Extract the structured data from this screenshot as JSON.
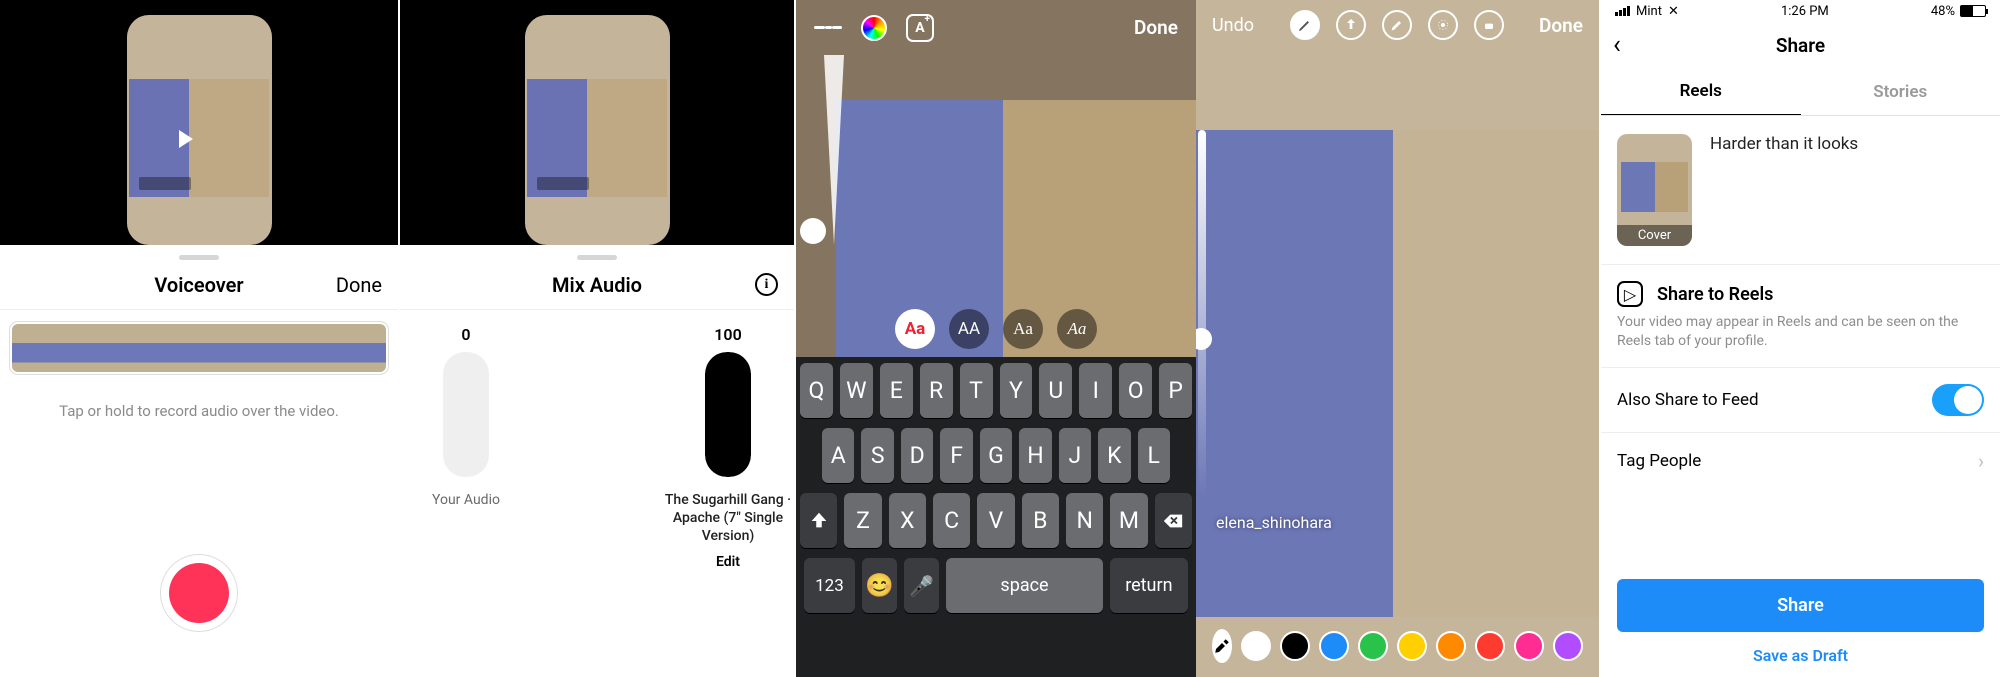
{
  "panel1": {
    "title": "Voiceover",
    "done": "Done",
    "hint": "Tap or hold to record audio over the video."
  },
  "panel2": {
    "title": "Mix Audio",
    "left": {
      "value": "0",
      "label": "Your Audio"
    },
    "right": {
      "value": "100",
      "label": "The Sugarhill Gang  ·\nApache (7\" Single Version)",
      "edit": "Edit"
    }
  },
  "panel3": {
    "done": "Done",
    "fonts": [
      "Aa",
      "AA",
      "Aa",
      "Aa"
    ],
    "keyboard": {
      "r1": [
        "Q",
        "W",
        "E",
        "R",
        "T",
        "Y",
        "U",
        "I",
        "O",
        "P"
      ],
      "r2": [
        "A",
        "S",
        "D",
        "F",
        "G",
        "H",
        "J",
        "K",
        "L"
      ],
      "r3": [
        "Z",
        "X",
        "C",
        "V",
        "B",
        "N",
        "M"
      ],
      "num": "123",
      "space": "space",
      "ret": "return"
    }
  },
  "panel4": {
    "undo": "Undo",
    "done": "Done",
    "tag": "elena_shinohara",
    "colors": [
      "#ffffff",
      "#000000",
      "#1d8cf8",
      "#29c24a",
      "#ffcf00",
      "#ff8a00",
      "#ff3b30",
      "#ff2d92",
      "#b24dff"
    ]
  },
  "panel5": {
    "status": {
      "carrier": "Mint",
      "time": "1:26 PM",
      "battery": "48%"
    },
    "title": "Share",
    "tabs": {
      "reels": "Reels",
      "stories": "Stories"
    },
    "caption": "Harder than it looks",
    "cover": "Cover",
    "shareReels": {
      "title": "Share to Reels",
      "sub": "Your video may appear in Reels and can be seen on the Reels tab of your profile."
    },
    "feed": "Also Share to Feed",
    "tag": "Tag People",
    "shareBtn": "Share",
    "draft": "Save as Draft"
  }
}
